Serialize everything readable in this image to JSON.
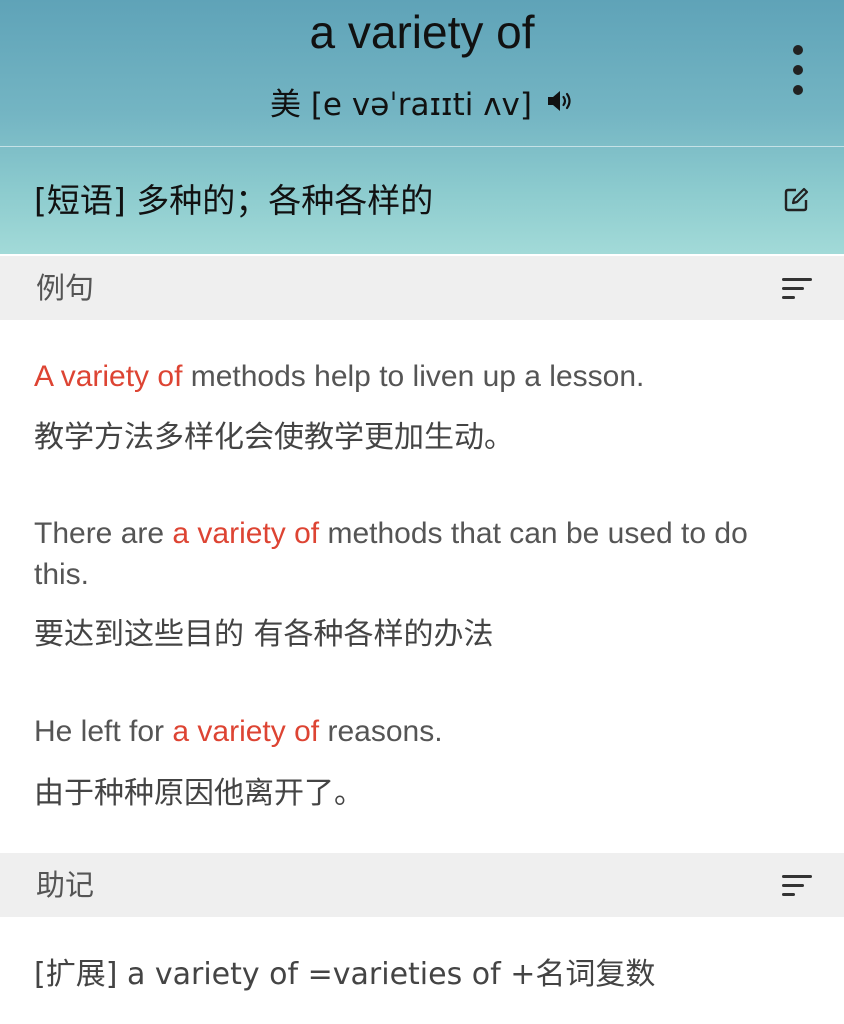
{
  "header": {
    "word": "a variety of",
    "phonetic": "美 [e vəˈraɪɪti ʌv]"
  },
  "definition": "[短语] 多种的；各种各样的",
  "sections": {
    "examples_title": "例句",
    "mnemonic_title": "助记"
  },
  "examples": [
    {
      "en": {
        "before": "",
        "highlight": "A variety of",
        "after": " methods help to liven up a lesson."
      },
      "zh": "教学方法多样化会使教学更加生动。"
    },
    {
      "en": {
        "before": "There are ",
        "highlight": "a variety of",
        "after": " methods that can be used to do this."
      },
      "zh": "要达到这些目的 有各种各样的办法"
    },
    {
      "en": {
        "before": "He left for ",
        "highlight": "a variety of",
        "after": " reasons."
      },
      "zh": "由于种种原因他离开了。"
    }
  ],
  "mnemonic": "[扩展] a variety of =varieties of +名词复数",
  "colors": {
    "highlight": "#dd4433",
    "section_bg": "#efefef",
    "hero_top": "#5fa3b8",
    "hero_bottom": "#a2dad8"
  },
  "icons": {
    "speaker": "speaker-icon",
    "more": "more-vertical-icon",
    "edit": "edit-icon",
    "sort": "sort-lines-icon"
  }
}
